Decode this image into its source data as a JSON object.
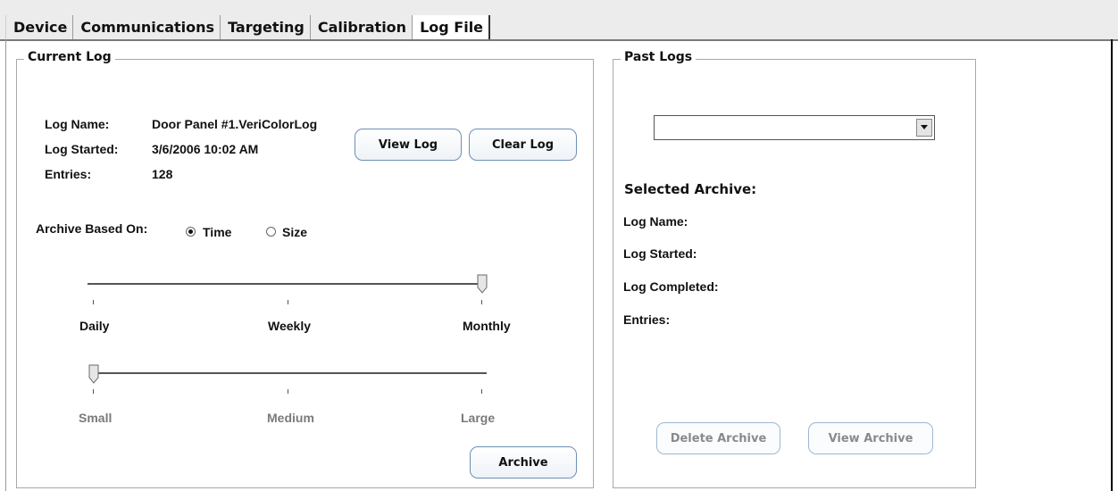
{
  "tabs": [
    {
      "label": "Device"
    },
    {
      "label": "Communications"
    },
    {
      "label": "Targeting"
    },
    {
      "label": "Calibration"
    },
    {
      "label": "Log File",
      "active": true
    }
  ],
  "current_log": {
    "title": "Current Log",
    "log_name_label": "Log Name:",
    "log_name_value": "Door Panel #1.VeriColorLog",
    "log_started_label": "Log Started:",
    "log_started_value": "3/6/2006 10:02 AM",
    "entries_label": "Entries:",
    "entries_value": "128",
    "view_log_button": "View Log",
    "clear_log_button": "Clear Log",
    "archive_based_on_label": "Archive Based On:",
    "radio_time": "Time",
    "radio_size": "Size",
    "selected_basis": "Time",
    "time_slider": {
      "ticks": [
        "Daily",
        "Weekly",
        "Monthly"
      ],
      "selected": "Monthly"
    },
    "size_slider": {
      "ticks": [
        "Small",
        "Medium",
        "Large"
      ],
      "selected": "Small",
      "enabled": false
    },
    "archive_button": "Archive"
  },
  "past_logs": {
    "title": "Past Logs",
    "dropdown_value": "",
    "selected_archive_heading": "Selected Archive:",
    "log_name_label": "Log Name:",
    "log_started_label": "Log Started:",
    "log_completed_label": "Log Completed:",
    "entries_label": "Entries:",
    "delete_archive_button": "Delete Archive",
    "view_archive_button": "View Archive"
  },
  "colors": {
    "button_border": "#6d8fb5",
    "tab_bar_bg": "#ececec",
    "disabled_text": "#7a7a7a"
  }
}
